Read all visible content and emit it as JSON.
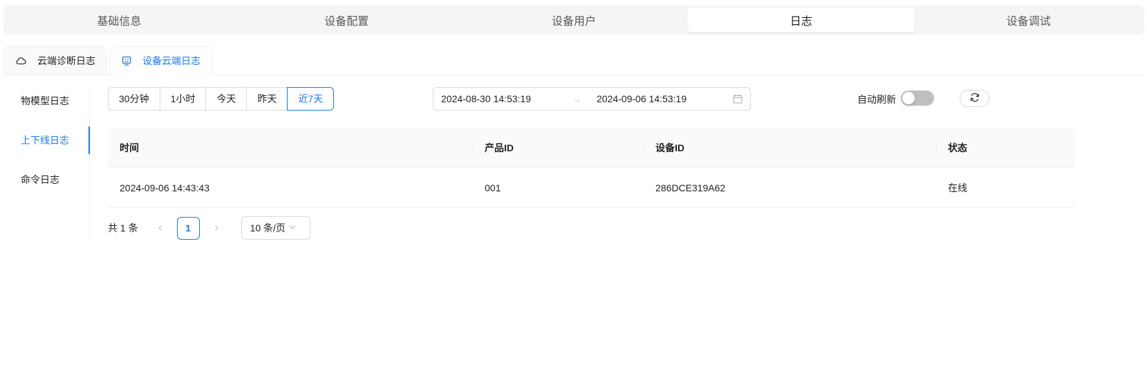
{
  "top_tabs": [
    "基础信息",
    "设备配置",
    "设备用户",
    "日志",
    "设备调试"
  ],
  "top_tabs_active": "日志",
  "card_tabs": [
    {
      "label": "云端诊断日志",
      "icon": "cloud-icon"
    },
    {
      "label": "设备云端日志",
      "icon": "device-icon"
    }
  ],
  "side_tabs": [
    "物模型日志",
    "上下线日志",
    "命令日志"
  ],
  "side_tabs_active": "上下线日志",
  "time_range": [
    "30分钟",
    "1小时",
    "今天",
    "昨天",
    "近7天"
  ],
  "time_range_active": "近7天",
  "date_range": {
    "start": "2024-08-30 14:53:19",
    "separator": "→",
    "end": "2024-09-06 14:53:19",
    "icon": "calendar-icon"
  },
  "auto_refresh": {
    "label": "自动刷新",
    "enabled": false
  },
  "refresh_icon": "refresh-icon",
  "table": {
    "columns": [
      "时间",
      "产品ID",
      "设备ID",
      "状态"
    ],
    "rows": [
      [
        "2024-09-06 14:43:43",
        "001",
        "286DCE319A62",
        "在线"
      ]
    ]
  },
  "pagination": {
    "total_text": "共 1 条",
    "current_page": "1",
    "page_size": "10 条/页",
    "prev_icon": "chevron-left-icon",
    "next_icon": "chevron-right-icon"
  },
  "colors": {
    "primary": "#1677ff",
    "border": "#d9d9d9",
    "header_bg": "#fafafa"
  }
}
